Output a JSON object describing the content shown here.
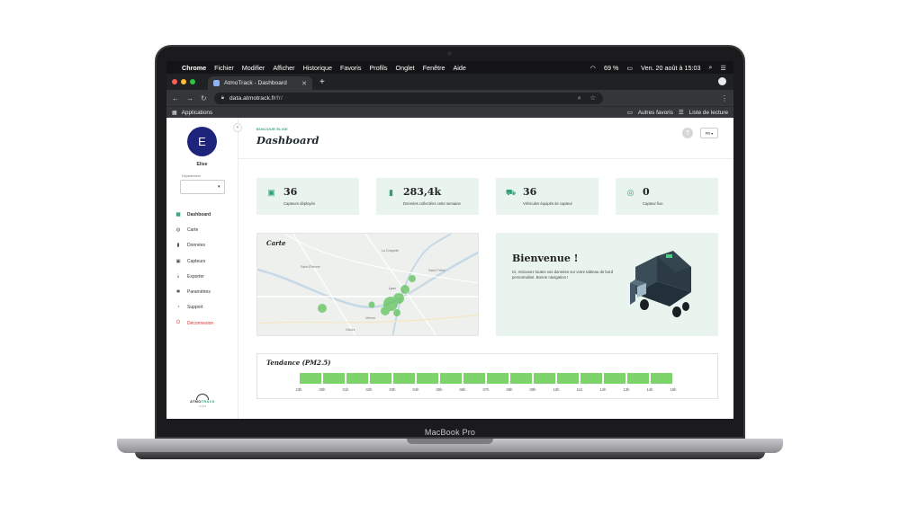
{
  "device": {
    "brand_label": "MacBook Pro"
  },
  "menubar": {
    "app_name": "Chrome",
    "items": [
      "Fichier",
      "Modifier",
      "Afficher",
      "Historique",
      "Favoris",
      "Profils",
      "Onglet",
      "Fenêtre",
      "Aide"
    ],
    "battery": "69 %",
    "datetime": "Ven. 20 août à 15:03"
  },
  "browser": {
    "tab_title": "AtmoTrack - Dashboard",
    "url_host": "data.atmotrack.fr",
    "url_path": "/fr/",
    "bookmarks_apps": "Applications",
    "bookmarks_other": "Autres favoris",
    "reading_list": "Liste de lecture"
  },
  "sidebar": {
    "avatar_letter": "E",
    "user_name": "Elise",
    "department_label": "Département",
    "department_value": "",
    "items": [
      {
        "label": "Dashboard",
        "icon": "grid-icon",
        "glyph": "▦",
        "active": true
      },
      {
        "label": "Carte",
        "icon": "globe-icon",
        "glyph": "◍"
      },
      {
        "label": "Données",
        "icon": "bar-chart-icon",
        "glyph": "▮"
      },
      {
        "label": "Capteurs",
        "icon": "sensor-icon",
        "glyph": "▣"
      },
      {
        "label": "Exporter",
        "icon": "download-icon",
        "glyph": "⤓"
      },
      {
        "label": "Paramètres",
        "icon": "gear-icon",
        "glyph": "✱"
      },
      {
        "label": "Support",
        "icon": "headset-icon",
        "glyph": "◔"
      },
      {
        "label": "Déconnexion",
        "icon": "power-icon",
        "glyph": "⏻",
        "logout": true
      }
    ],
    "logo_text_a": "ATMO",
    "logo_text_b": "TRACK",
    "version": "v1.6.0"
  },
  "header": {
    "greeting": "BONJOUR ELISE",
    "title": "Dashboard",
    "help": "?",
    "language": "FR ▾"
  },
  "stats": [
    {
      "value": "36",
      "label": "Capteurs déployés",
      "icon": "sensor-box-icon",
      "glyph": "▣"
    },
    {
      "value": "283,4k",
      "label": "Données collectées cette semaine",
      "icon": "bar-chart-icon",
      "glyph": "▮"
    },
    {
      "value": "36",
      "label": "Véhicules équipés de capteur",
      "icon": "car-icon",
      "glyph": "⛟"
    },
    {
      "value": "0",
      "label": "Capteur fixe",
      "icon": "target-icon",
      "glyph": "◎"
    }
  ],
  "map": {
    "title": "Carte",
    "places": [
      "La Chapelle",
      "Lyon",
      "Saint-Étienne",
      "Vienne",
      "Givors",
      "Saint-Priest"
    ]
  },
  "welcome": {
    "title": "Bienvenue !",
    "text": "Ici, retrouvez toutes vos données sur votre tableau de bord personnalisé. Bonne navigation !"
  },
  "trend": {
    "title": "Tendance (PM2.5)",
    "hours": [
      "23h",
      "00h",
      "01h",
      "02h",
      "03h",
      "04h",
      "05h",
      "06h",
      "07h",
      "08h",
      "09h",
      "10h",
      "11h",
      "12h",
      "13h",
      "14h",
      "15h"
    ],
    "bar_color": "#7dd46a"
  },
  "colors": {
    "accent": "#2f9e73",
    "navy": "#1e237b",
    "danger": "#d93030",
    "card_bg": "#e9f4ee"
  }
}
